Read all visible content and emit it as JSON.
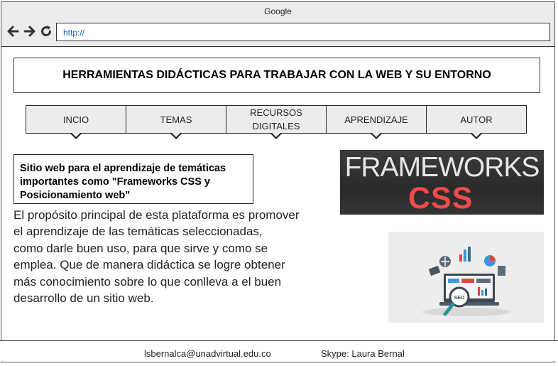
{
  "browser": {
    "title": "Google",
    "url": "http://"
  },
  "header": {
    "title": "HERRAMIENTAS DIDÁCTICAS PARA TRABAJAR CON LA WEB Y SU ENTORNO"
  },
  "menu": {
    "items": [
      {
        "label": "INCIO"
      },
      {
        "label": "TEMAS"
      },
      {
        "label": "RECURSOS\nDIGITALES"
      },
      {
        "label": "APRENDIZAJE"
      },
      {
        "label": "AUTOR"
      }
    ]
  },
  "content": {
    "subtitle": "Sitio web para el aprendizaje de temáticas\n importantes como \"Frameworks CSS y\nPosicionamiento web\"",
    "paragraph": "El propósito principal de esta plataforma es promover\nel aprendizaje de las temáticas seleccionadas,\ncomo darle buen uso, para que sirve y como se\nemplea. Que de manera didáctica se logre obtener\nmás conocimiento sobre lo que conlleva a el buen\ndesarrollo de un sitio web."
  },
  "images": {
    "frameworks": {
      "word": "FRAMEWORKS",
      "css": "CSS"
    },
    "seo": {
      "label": "SEO",
      "icon": "seo-illustration"
    }
  },
  "footer": {
    "email": "lsbernalca@unadvirtual.edu.co",
    "skype": "Skype: Laura Bernal"
  },
  "colors": {
    "accent_red": "#f24a4a",
    "url_blue": "#1a5bbf",
    "menu_bg": "#ececec"
  }
}
